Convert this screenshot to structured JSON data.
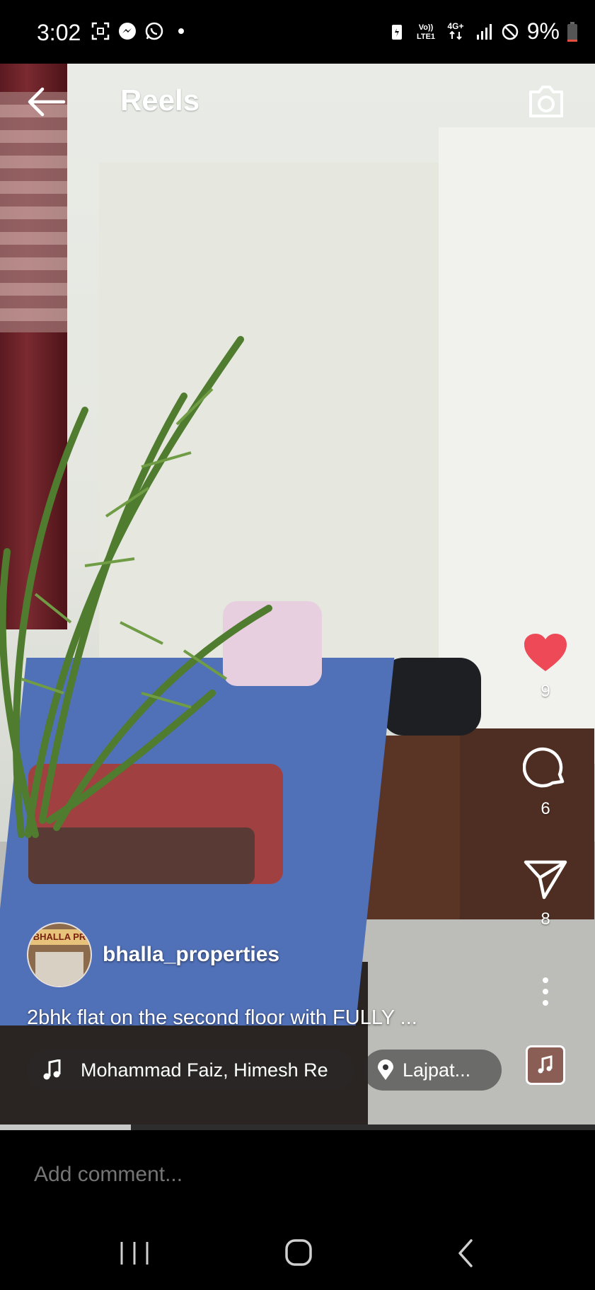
{
  "status_bar": {
    "time": "3:02",
    "left_icons": [
      "screenshot-icon",
      "messenger-icon",
      "whatsapp-icon",
      "dot-icon"
    ],
    "right_icons": [
      "battery-saver-icon",
      "volte-icon",
      "4g-icon",
      "signal-icon",
      "do-not-disturb-icon"
    ],
    "network_top": "Vo))",
    "network_bottom": "LTE1",
    "data_type": "4G+",
    "battery": "9%"
  },
  "header": {
    "title": "Reels"
  },
  "actions": {
    "likes": "9",
    "comments": "6",
    "shares": "8"
  },
  "post": {
    "username": "bhalla_properties",
    "avatar_sign": "BHALLA PR",
    "caption": "2bhk flat on the second floor with FULLY ...",
    "audio": "Mohammad Faiz, Himesh Re",
    "location": "Lajpat...",
    "progress_fraction": 0.22
  },
  "comment": {
    "placeholder": "Add comment..."
  },
  "colors": {
    "like_red": "#ed4956",
    "background": "#000000"
  }
}
